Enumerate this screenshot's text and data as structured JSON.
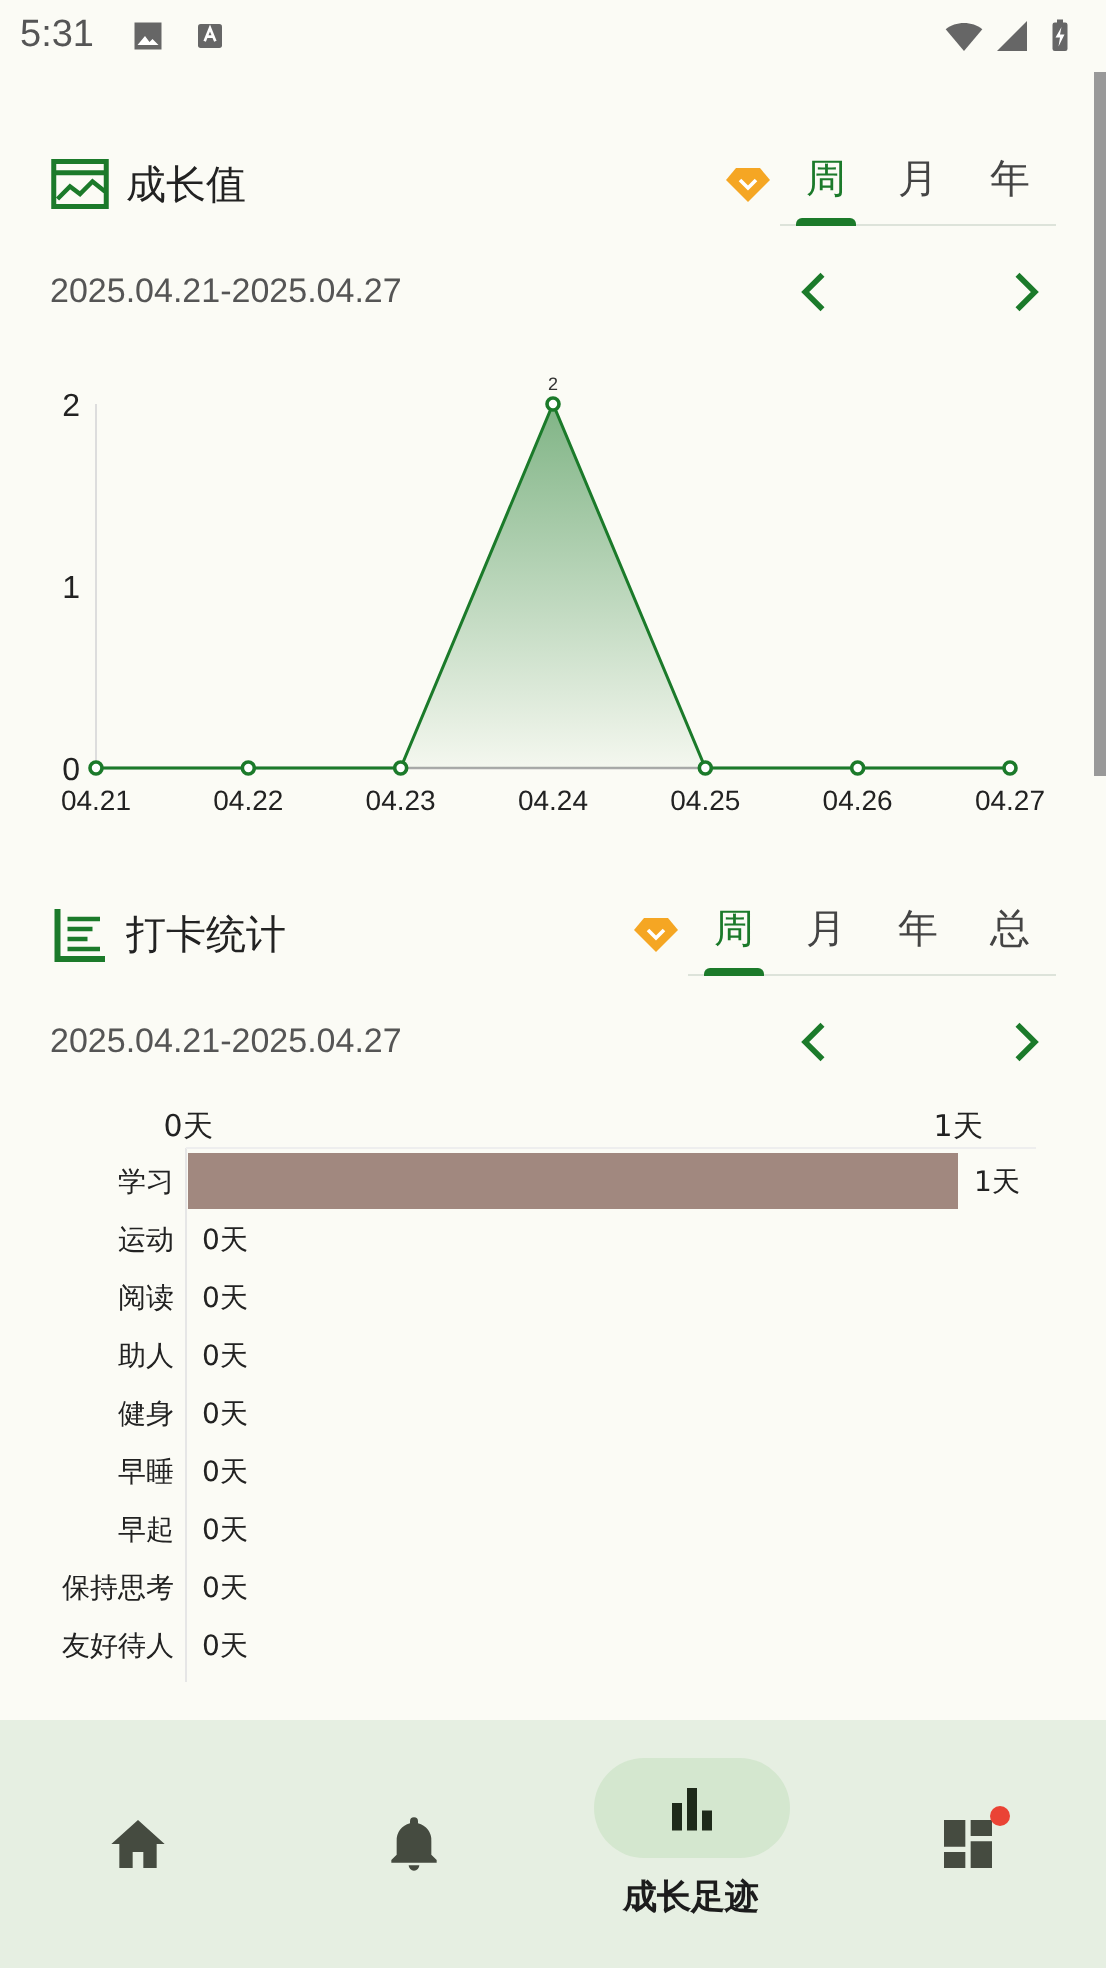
{
  "status_bar": {
    "time": "5:31"
  },
  "growth": {
    "title": "成长值",
    "tabs": [
      {
        "label": "周",
        "selected": true
      },
      {
        "label": "月",
        "selected": false
      },
      {
        "label": "年",
        "selected": false
      }
    ],
    "date_range": "2025.04.21-2025.04.27",
    "chart_data": {
      "type": "area",
      "categories": [
        "04.21",
        "04.22",
        "04.23",
        "04.24",
        "04.25",
        "04.26",
        "04.27"
      ],
      "series": [
        {
          "color": "#1b7a2a",
          "values": [
            0,
            0,
            0,
            2,
            0,
            0,
            0
          ]
        }
      ],
      "ylim": [
        0,
        2
      ],
      "yticks": [
        0,
        1,
        2
      ],
      "value_labels": [
        null,
        null,
        null,
        "2",
        null,
        null,
        null
      ]
    }
  },
  "checkin": {
    "title": "打卡统计",
    "tabs": [
      {
        "label": "周",
        "selected": true
      },
      {
        "label": "月",
        "selected": false
      },
      {
        "label": "年",
        "selected": false
      },
      {
        "label": "总",
        "selected": false
      }
    ],
    "date_range": "2025.04.21-2025.04.27",
    "chart_data": {
      "type": "bar",
      "orientation": "horizontal",
      "categories": [
        "学习",
        "运动",
        "阅读",
        "助人",
        "健身",
        "早睡",
        "早起",
        "保持思考",
        "友好待人"
      ],
      "series": [
        {
          "color": "#a1887f",
          "values": [
            1,
            0,
            0,
            0,
            0,
            0,
            0,
            0,
            0
          ]
        }
      ],
      "xlim": [
        0,
        1
      ],
      "xticks": [
        {
          "value": 0,
          "label": "0天"
        },
        {
          "value": 1,
          "label": "1天"
        }
      ],
      "value_labels": [
        "1天",
        "0天",
        "0天",
        "0天",
        "0天",
        "0天",
        "0天",
        "0天",
        "0天"
      ]
    }
  },
  "bottom_nav": [
    {
      "kind": "home",
      "selected": false
    },
    {
      "kind": "bell",
      "selected": false
    },
    {
      "kind": "chart",
      "selected": true,
      "label": "成长足迹"
    },
    {
      "kind": "dashboard",
      "selected": false,
      "badge": true
    }
  ]
}
